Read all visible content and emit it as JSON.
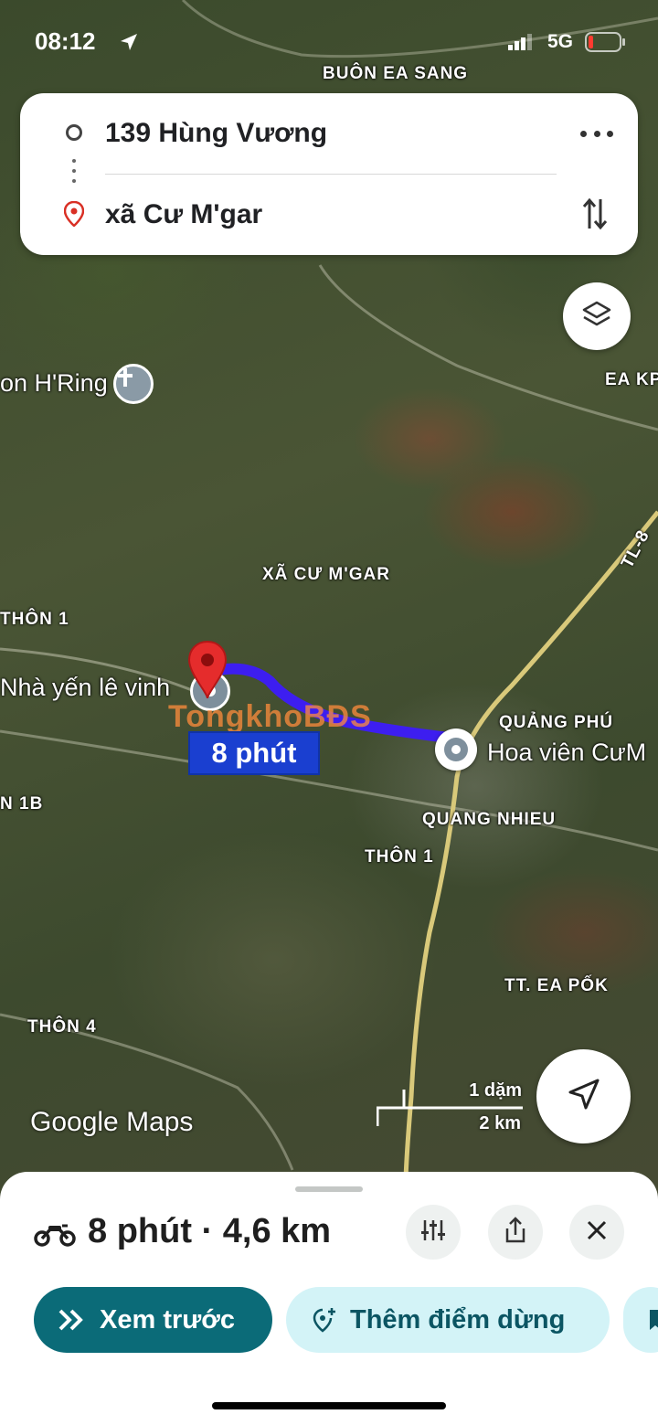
{
  "status_bar": {
    "time": "08:12",
    "network": "5G"
  },
  "route": {
    "origin": "139 Hùng Vương",
    "destination": "xã Cư M'gar"
  },
  "map": {
    "places": {
      "buon_ea_sang": "BUÔN EA SANG",
      "ea_kp": "EA KP",
      "xa_cu_mgar": "XÃ CƯ M'GAR",
      "thon_1_left": "THÔN 1",
      "n_1b": "N 1B",
      "quang_phu": "QUẢNG PHÚ",
      "quang_nhieu": "QUANG NHIEU",
      "thon_1_mid": "THÔN 1",
      "tt_ea_pok": "TT. EA PỐK",
      "thon_4": "THÔN 4",
      "tl8": "TL-8"
    },
    "pois": {
      "hring": "on H'Ring",
      "nha_yen": "Nhà yến lê vinh",
      "hoa_vien": "Hoa viên CưM"
    },
    "duration_label": "8 phút",
    "watermark": "TongkhoBĐS",
    "logo": "Google Maps",
    "scale": {
      "miles": "1 dặm",
      "km": "2 km"
    },
    "route_color": "#3d1ef0"
  },
  "trip": {
    "summary": "8 phút · 4,6 km",
    "mode_icon": "motorcycle-icon"
  },
  "actions": {
    "preview": "Xem trước",
    "add_stop": "Thêm điểm dừng"
  },
  "colors": {
    "preview_bg": "#0b6b78",
    "add_stop_bg": "#d3f3f7",
    "add_stop_text": "#0b5563"
  }
}
